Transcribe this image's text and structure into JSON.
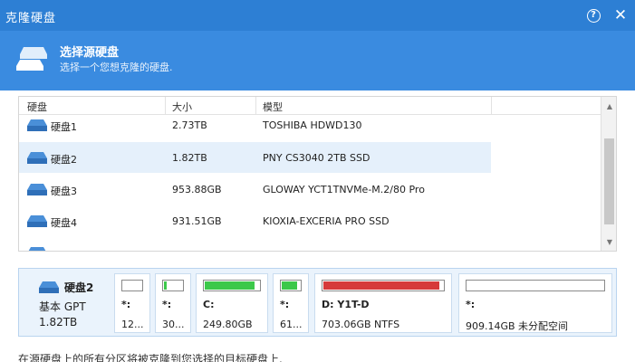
{
  "window": {
    "title": "克隆硬盘",
    "help_symbol": "?",
    "close_symbol": "✕",
    "color": "#2d7fd4"
  },
  "header": {
    "title": "选择源硬盘",
    "subtitle": "选择一个您想克隆的硬盘.",
    "icon": "disk-clone-icon",
    "color": "#3a8be0"
  },
  "table": {
    "columns": [
      "硬盘",
      "大小",
      "模型"
    ],
    "rows": [
      {
        "name": "硬盘1",
        "size": "2.73TB",
        "model": "TOSHIBA HDWD130"
      },
      {
        "name": "硬盘2",
        "size": "1.82TB",
        "model": "PNY CS3040 2TB SSD"
      },
      {
        "name": "硬盘3",
        "size": "953.88GB",
        "model": "GLOWAY YCT1TNVMe-M.2/80 Pro"
      },
      {
        "name": "硬盘4",
        "size": "931.51GB",
        "model": "KIOXIA-EXCERIA PRO SSD"
      },
      {
        "name": "",
        "size": "",
        "model": ""
      }
    ],
    "selected_row": 1,
    "selected_color": "#e5f0fb"
  },
  "disk_map": {
    "name": "硬盘2",
    "type": "基本 GPT",
    "size": "1.82TB",
    "partitions": [
      {
        "letter": "*:",
        "capacity": "12...",
        "used": 0.0,
        "color": "#ffffff"
      },
      {
        "letter": "*:",
        "capacity": "30...",
        "used": 0.15,
        "color": "#3cc84a"
      },
      {
        "letter": "C:",
        "capacity": "249.80GB",
        "used": 0.92,
        "color": "#3cc84a"
      },
      {
        "letter": "*:",
        "capacity": "61...",
        "used": 0.85,
        "color": "#3cc84a"
      },
      {
        "letter": "D: Y1T-D",
        "capacity": "703.06GB NTFS",
        "used": 0.97,
        "color": "#d63a3a"
      },
      {
        "letter": "*:",
        "capacity": "909.14GB 未分配空间",
        "used": 0.0,
        "color": "#ffffff"
      }
    ]
  },
  "footer": {
    "text": "在源硬盘上的所有分区将被克隆到您选择的目标硬盘上."
  }
}
